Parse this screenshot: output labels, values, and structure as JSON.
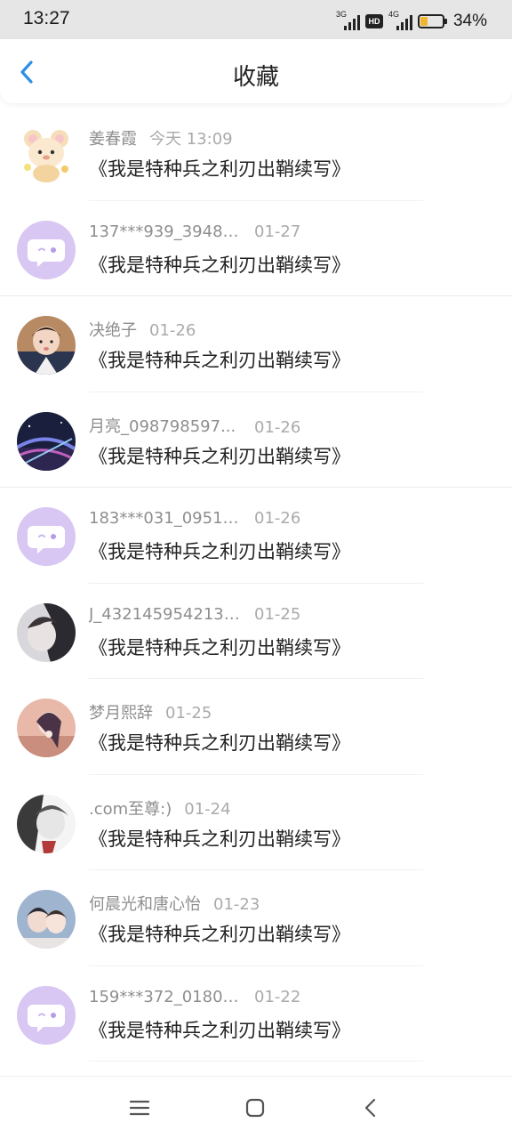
{
  "status_bar": {
    "time": "13:27",
    "net1": "3G",
    "hd": "HD",
    "net2": "4G",
    "battery_pct": "34%",
    "battery_level": 0.34,
    "battery_color": "#f2b531"
  },
  "header": {
    "title": "收藏",
    "back_icon": "chevron-left-icon",
    "accent": "#2b8fe5"
  },
  "items": [
    {
      "name": "姜春霞",
      "time": "今天 13:09",
      "content": "《我是特种兵之利刃出鞘续写》",
      "avatar": "cartoon-bear-avatar"
    },
    {
      "name": "137***939_39484...",
      "time": "01-27",
      "content": "《我是特种兵之利刃出鞘续写》",
      "avatar": "default-chat-avatar"
    },
    {
      "name": "决绝子",
      "time": "01-26",
      "content": "《我是特种兵之利刃出鞘续写》",
      "avatar": "photo-avatar"
    },
    {
      "name": "月亮_098798597...",
      "time": "01-26",
      "content": "《我是特种兵之利刃出鞘续写》",
      "avatar": "photo-avatar"
    },
    {
      "name": "183***031_09512...",
      "time": "01-26",
      "content": "《我是特种兵之利刃出鞘续写》",
      "avatar": "default-chat-avatar"
    },
    {
      "name": "J_4321459542131...",
      "time": "01-25",
      "content": "《我是特种兵之利刃出鞘续写》",
      "avatar": "photo-avatar"
    },
    {
      "name": "梦月熙辞",
      "time": "01-25",
      "content": "《我是特种兵之利刃出鞘续写》",
      "avatar": "photo-avatar"
    },
    {
      "name": ".com至尊:)",
      "time": "01-24",
      "content": "《我是特种兵之利刃出鞘续写》",
      "avatar": "photo-avatar"
    },
    {
      "name": "何晨光和唐心怡",
      "time": "01-23",
      "content": "《我是特种兵之利刃出鞘续写》",
      "avatar": "photo-avatar"
    },
    {
      "name": "159***372_01801...",
      "time": "01-22",
      "content": "《我是特种兵之利刃出鞘续写》",
      "avatar": "default-chat-avatar"
    }
  ],
  "nav": {
    "menu_icon": "menu-icon",
    "home_icon": "home-icon",
    "back_icon": "back-icon"
  }
}
